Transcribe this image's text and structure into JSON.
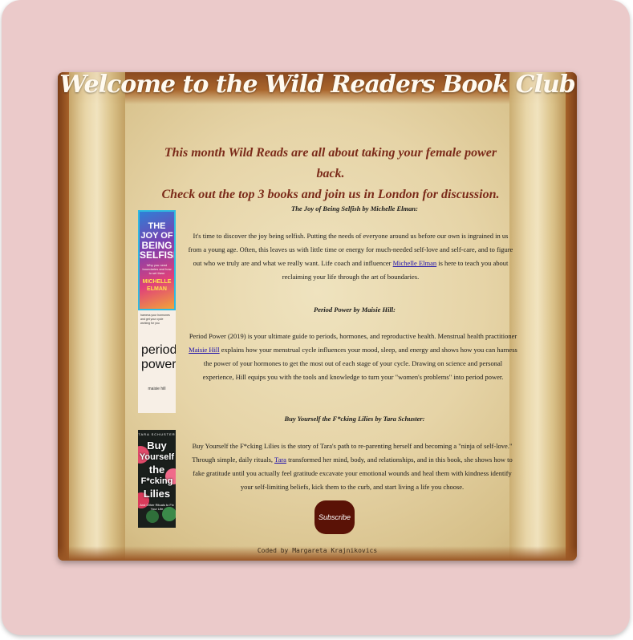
{
  "page": {
    "title": "Welcome to the Wild Readers Book Club",
    "intro_line1": "This month Wild Reads are all about taking your female power back.",
    "intro_line2": "Check out the top 3 books and join us in London for discussion."
  },
  "books": [
    {
      "title": "The Joy of Being Selfish by Michelle Elman:",
      "desc_before": "It's time to discover the joy being selfish. Putting the needs of everyone around us before our own is ingrained in us from a young age. Often, this leaves us with little time or energy for much-needed self-love and self-care, and to figure out who we truly are and what we really want. Life coach and influencer ",
      "link": "Michelle Elman",
      "desc_after": " is here to teach you about reclaiming your life through the art of boundaries.",
      "cover": {
        "line1": "THE",
        "line2": "JOY OF",
        "line3": "BEING",
        "line4": "SELFISH",
        "subtitle": "Why you need boundaries and how to set them",
        "author1": "MICHELLE",
        "author2": "ELMAN"
      }
    },
    {
      "title": "Period Power by Maisie Hill:",
      "desc_before": "Period Power (2019) is your ultimate guide to periods, hormones, and reproductive health. Menstrual health practitioner ",
      "link": "Maisie Hill",
      "desc_after": " explains how your menstrual cycle influences your mood, sleep, and energy and shows how you can harness the power of your hormones to get the most out of each stage of your cycle. Drawing on science and personal experience, Hill equips you with the tools and knowledge to turn your \"women's problems\" into period power.",
      "cover": {
        "tagline": "harness your hormones and get your cycle working for you",
        "line1": "period",
        "line2": "power",
        "dot": ".",
        "author": "maisie hill"
      }
    },
    {
      "title": "Buy Yourself the F*cking Lilies by Tara Schuster:",
      "desc_before": "Buy Yourself the F*cking Lilies is the story of Tara's path to re-parenting herself and becoming a \"ninja of self-love.\" Through simple, daily rituals, ",
      "link": "Tara",
      "desc_after": " transformed her mind, body, and relationships, and in this book, she shows how to fake gratitude until you actually feel gratitude excavate your emotional wounds and heal them with kindness identify your self-limiting beliefs, kick them to the curb, and start living a life you choose.",
      "cover": {
        "author_top": "TARA SCHUSTER",
        "line1": "Buy",
        "line2": "Yourself",
        "line3": "the",
        "line4": "F*cking",
        "line5": "Lilies",
        "tagline": "And Other Rituals to Fix Your Life"
      }
    }
  ],
  "subscribe_label": "Subscribe",
  "credit": "Coded by Margareta Krajnikovics",
  "colors": {
    "page_bg": "#ebcaca",
    "title_text": "#fffaf0",
    "intro_text": "#7b2b1a",
    "button_bg": "#5a1206",
    "link": "#1a0dab"
  }
}
